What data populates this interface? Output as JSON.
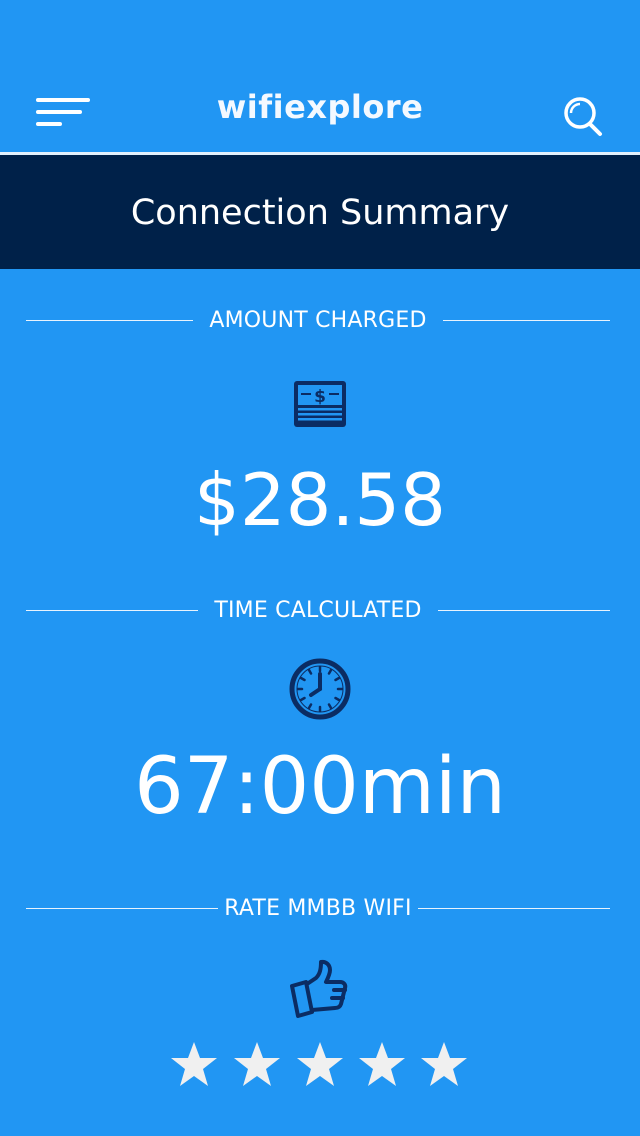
{
  "header": {
    "app_title": "wifiexplore",
    "menu_icon": "menu-icon",
    "search_icon": "search-icon"
  },
  "banner": {
    "title": "Connection Summary"
  },
  "sections": {
    "amount": {
      "label": "AMOUNT CHARGED",
      "icon": "bill-icon",
      "value": "$28.58"
    },
    "time": {
      "label": "TIME CALCULATED",
      "icon": "clock-icon",
      "value": "67:00min"
    },
    "rate": {
      "label": "RATE MMBB WIFI",
      "icon": "thumbs-up-icon",
      "stars_total": 5,
      "stars_selected": 0
    }
  },
  "colors": {
    "background": "#2196f3",
    "banner": "#002149",
    "icon_dark": "#0b2c63",
    "star": "#f0f0f0",
    "text": "#ffffff"
  }
}
